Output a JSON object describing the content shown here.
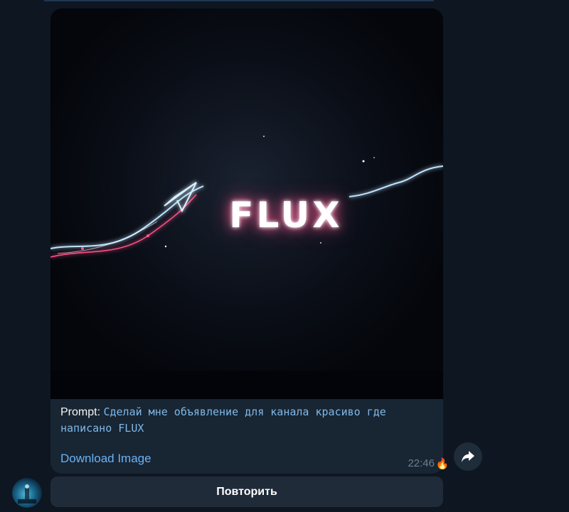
{
  "message": {
    "image": {
      "word": "FLUX"
    },
    "caption": {
      "label": "Prompt:",
      "text": "Сделай мне объявление для канала красиво где написано FLUX"
    },
    "download_label": "Download Image",
    "time": "22:46",
    "reaction_emoji": "🔥",
    "forward_icon": "share-arrow-icon"
  },
  "repeat_button": {
    "label": "Повторить"
  },
  "colors": {
    "background": "#0e1621",
    "bubble": "#182533",
    "link": "#6ab3f3",
    "button": "#1f2b38"
  }
}
